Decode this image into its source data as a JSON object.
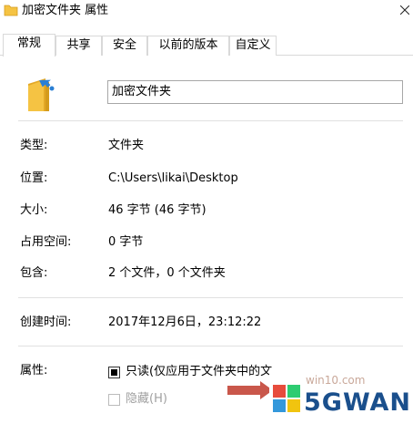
{
  "window": {
    "title": "加密文件夹 属性"
  },
  "tabs": [
    "常规",
    "共享",
    "安全",
    "以前的版本",
    "自定义"
  ],
  "active_tab": "常规",
  "name_field": {
    "value": "加密文件夹"
  },
  "details": {
    "type": {
      "label": "类型:",
      "value": "文件夹"
    },
    "location": {
      "label": "位置:",
      "value": "C:\\Users\\likai\\Desktop"
    },
    "size": {
      "label": "大小:",
      "value": "46 字节 (46 字节)"
    },
    "size_on_disk": {
      "label": "占用空间:",
      "value": "0 字节"
    },
    "contains": {
      "label": "包含:",
      "value": "2 个文件，0 个文件夹"
    },
    "created": {
      "label": "创建时间:",
      "value": "2017年12月6日，23:12:22"
    }
  },
  "attributes": {
    "label": "属性:",
    "readonly_label": "只读(仅应用于文件夹中的文",
    "readonly_state": "indeterminate",
    "hidden_label": "隐藏(H)",
    "hidden_state": "unchecked-disabled"
  },
  "watermark": {
    "small_text": "win10.com",
    "brand_text": "5GWAN"
  },
  "colors": {
    "folder_yellow": "#f5c343",
    "folder_dark": "#e3a826",
    "share_badge": "#2a7fd4",
    "watermark_blue": "#1a4f8c",
    "arrow_red": "#c0392b"
  },
  "icons": [
    "folder-icon",
    "close-icon",
    "share-badge-icon",
    "arrow-icon",
    "windows-logo-icon"
  ]
}
